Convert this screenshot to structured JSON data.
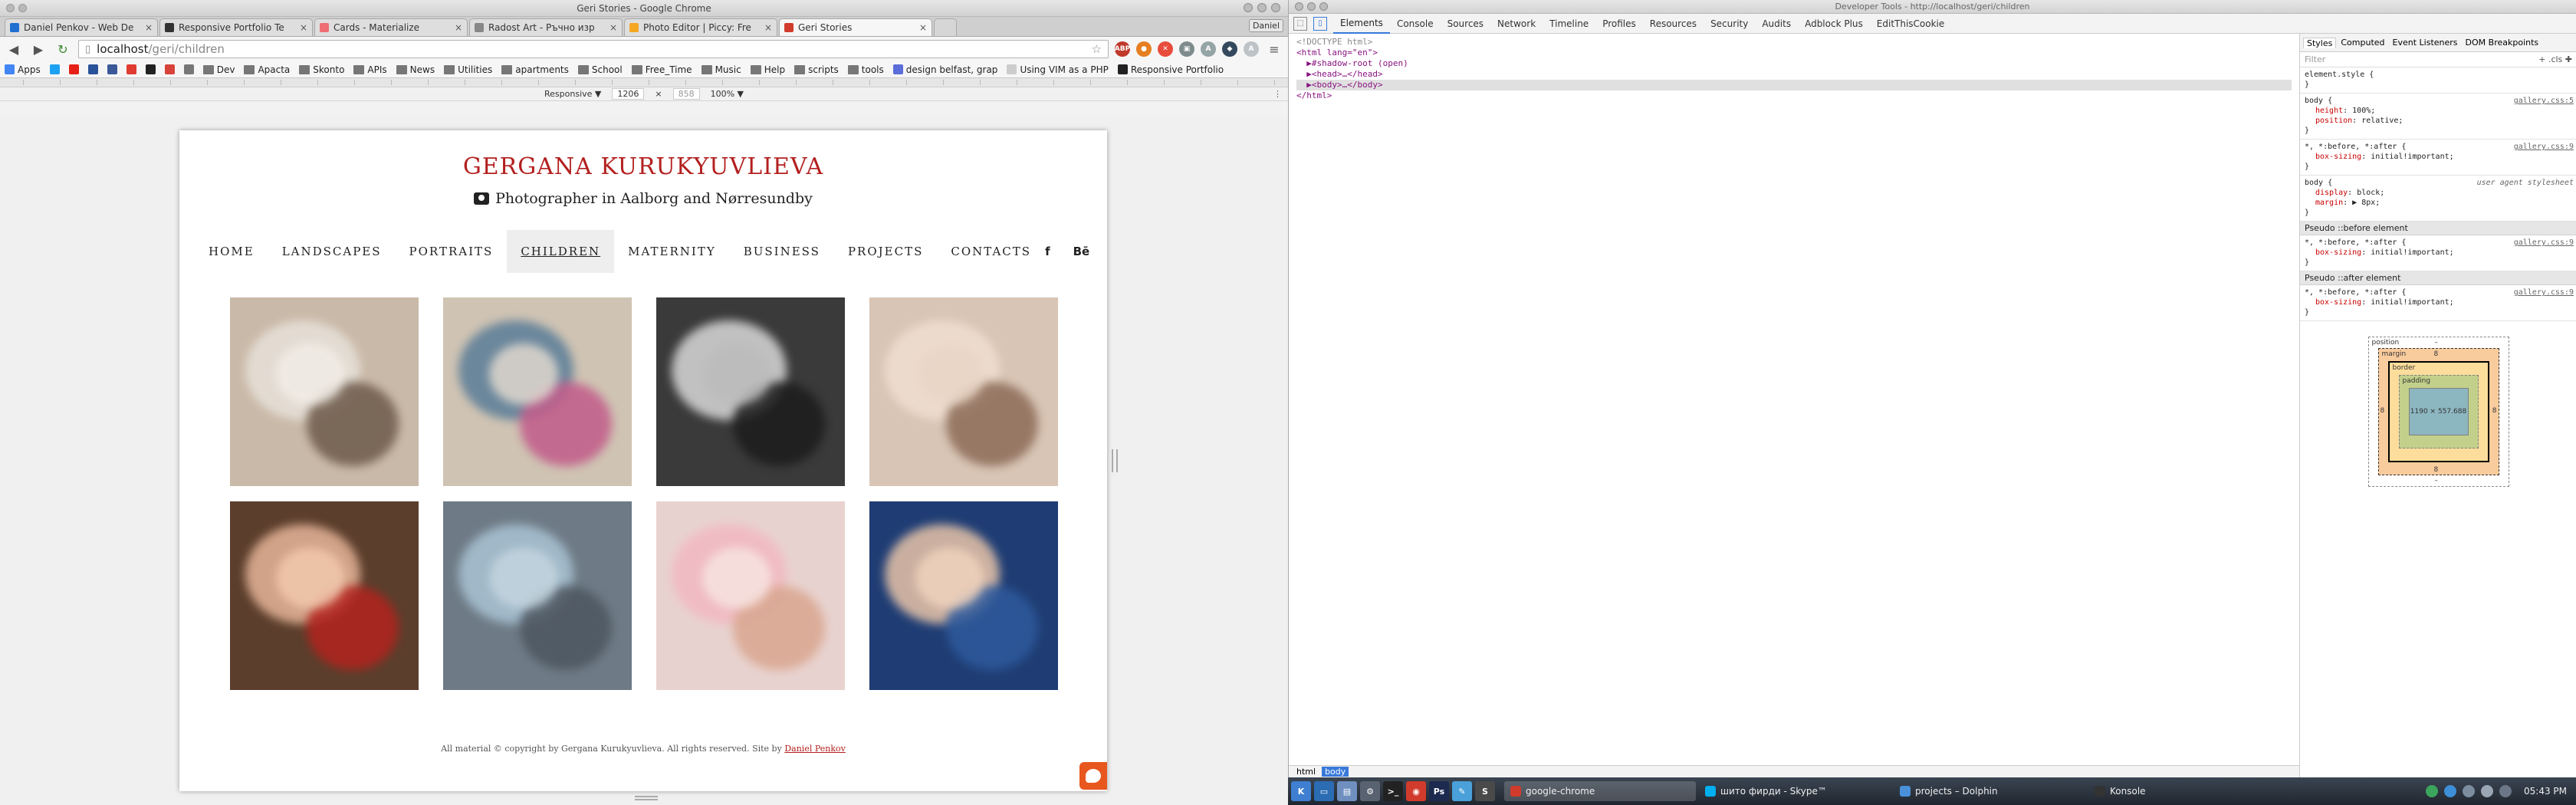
{
  "chrome": {
    "window_title": "Geri Stories - Google Chrome",
    "tabs": [
      {
        "label": "Daniel Penkov - Web De",
        "icon_color": "#1f6fd1",
        "active": false
      },
      {
        "label": "Responsive Portfolio Te",
        "icon_color": "#333333",
        "active": false
      },
      {
        "label": "Cards - Materialize",
        "icon_color": "#ee6e73",
        "active": false
      },
      {
        "label": "Radost Art - Ръчно изр",
        "icon_color": "#888888",
        "active": false
      },
      {
        "label": "Photo Editor | Piccy: Fre",
        "icon_color": "#f5a623",
        "active": false
      },
      {
        "label": "Geri Stories",
        "icon_color": "#d13b2c",
        "active": true
      }
    ],
    "user_label": "Daniel",
    "address": {
      "host": "localhost",
      "path": "/geri/children"
    },
    "bookmarks": [
      {
        "label": "Apps",
        "kind": "site",
        "color": "#4285f4"
      },
      {
        "label": "",
        "kind": "site",
        "color": "#1da1f2"
      },
      {
        "label": "",
        "kind": "site",
        "color": "#e62117"
      },
      {
        "label": "",
        "kind": "site",
        "color": "#2a5298"
      },
      {
        "label": "",
        "kind": "site",
        "color": "#3b5998"
      },
      {
        "label": "",
        "kind": "site",
        "color": "#e03c31"
      },
      {
        "label": "",
        "kind": "site",
        "color": "#222222"
      },
      {
        "label": "",
        "kind": "site",
        "color": "#d7433a"
      },
      {
        "label": "",
        "kind": "site",
        "color": "#777777"
      },
      {
        "label": "Dev",
        "kind": "folder"
      },
      {
        "label": "Apacta",
        "kind": "folder"
      },
      {
        "label": "Skonto",
        "kind": "folder"
      },
      {
        "label": "APIs",
        "kind": "folder"
      },
      {
        "label": "News",
        "kind": "folder"
      },
      {
        "label": "Utilities",
        "kind": "folder"
      },
      {
        "label": "apartments",
        "kind": "folder"
      },
      {
        "label": "School",
        "kind": "folder"
      },
      {
        "label": "Free_Time",
        "kind": "folder"
      },
      {
        "label": "Music",
        "kind": "folder"
      },
      {
        "label": "Help",
        "kind": "folder"
      },
      {
        "label": "scripts",
        "kind": "folder"
      },
      {
        "label": "tools",
        "kind": "folder"
      },
      {
        "label": "design belfast, grap",
        "kind": "site",
        "color": "#5b6dd8"
      },
      {
        "label": "Using VIM as a PHP",
        "kind": "site",
        "color": "#cccccc"
      },
      {
        "label": "Responsive Portfolio",
        "kind": "site",
        "color": "#222222"
      }
    ],
    "device_bar": {
      "mode": "Responsive ▼",
      "width": "1206",
      "height": "858",
      "zoom": "100% ▼"
    }
  },
  "site": {
    "title": "GERGANA KURUKYUVLIEVA",
    "subtitle": "Photographer in Aalborg and Nørresundby",
    "nav": [
      {
        "label": "HOME",
        "active": false
      },
      {
        "label": "LANDSCAPES",
        "active": false
      },
      {
        "label": "PORTRAITS",
        "active": false
      },
      {
        "label": "CHILDREN",
        "active": true
      },
      {
        "label": "MATERNITY",
        "active": false
      },
      {
        "label": "BUSINESS",
        "active": false
      },
      {
        "label": "PROJECTS",
        "active": false
      },
      {
        "label": "CONTACTS",
        "active": false
      }
    ],
    "social": [
      {
        "name": "facebook-icon",
        "glyph": "f"
      },
      {
        "name": "behance-icon",
        "glyph": "Bē"
      },
      {
        "name": "instagram-icon",
        "glyph": "◙"
      }
    ],
    "photos": [
      {
        "name": "photo-baby-on-fur-rug",
        "bg": "#c9b9a8",
        "blobs": [
          "#e8e2da",
          "#6d5a4b",
          "#f1ede6"
        ]
      },
      {
        "name": "photo-two-kids-lying",
        "bg": "#cfc3b3",
        "blobs": [
          "#5a7d98",
          "#c25b8a",
          "#e0d8ce"
        ]
      },
      {
        "name": "photo-sisters-bw",
        "bg": "#3a3a3a",
        "blobs": [
          "#d9d9d9",
          "#1c1c1c",
          "#bcbcbc"
        ]
      },
      {
        "name": "photo-baby-closeup",
        "bg": "#d9c5b5",
        "blobs": [
          "#f0dfd1",
          "#8b6b57",
          "#ead6c7"
        ]
      },
      {
        "name": "photo-baby-red-outfit",
        "bg": "#5b3e2c",
        "blobs": [
          "#e6b599",
          "#b2231e",
          "#f2c9ae"
        ]
      },
      {
        "name": "photo-baby-blue-hat",
        "bg": "#6e7b86",
        "blobs": [
          "#a9c3d4",
          "#4d5660",
          "#c4d5df"
        ]
      },
      {
        "name": "photo-baby-pink-headband",
        "bg": "#e8d2cf",
        "blobs": [
          "#f2b8c1",
          "#d9a68f",
          "#f7e4e1"
        ]
      },
      {
        "name": "photo-newborn-sleeping",
        "bg": "#1f3d74",
        "blobs": [
          "#e8c4a8",
          "#2e5a9c",
          "#f0d3bd"
        ]
      }
    ],
    "footer": {
      "text": "All material © copyright by Gergana Kurukyuvlieva. All rights reserved. Site by",
      "link": "Daniel Penkov"
    }
  },
  "devtools": {
    "window_title": "Developer Tools - http://localhost/geri/children",
    "tabs": [
      "Elements",
      "Console",
      "Sources",
      "Network",
      "Timeline",
      "Profiles",
      "Resources",
      "Security",
      "Audits",
      "Adblock Plus",
      "EditThisCookie"
    ],
    "active_tab": "Elements",
    "dom_lines": [
      {
        "text": "<!DOCTYPE html>",
        "kind": "comment",
        "sel": false
      },
      {
        "text": "<html lang=\"en\">",
        "kind": "tag",
        "sel": false
      },
      {
        "text": "  ▶#shadow-root (open)",
        "kind": "tag",
        "sel": false
      },
      {
        "text": "  ▶<head>…</head>",
        "kind": "tag",
        "sel": false
      },
      {
        "text": "  ▶<body>…</body>",
        "kind": "tag",
        "sel": true
      },
      {
        "text": "</html>",
        "kind": "tag",
        "sel": false
      }
    ],
    "breadcrumbs": [
      {
        "label": "html",
        "sel": false
      },
      {
        "label": "body",
        "sel": true
      }
    ],
    "styles_tabs": [
      "Styles",
      "Computed",
      "Event Listeners",
      "DOM Breakpoints"
    ],
    "filter_placeholder": "Filter",
    "filter_tools": "+  .cls  ✚",
    "rules": [
      {
        "selector": "element.style {",
        "source": "",
        "ua": false,
        "props": [],
        "close": "}"
      },
      {
        "selector": "body {",
        "source": "gallery.css:5",
        "ua": false,
        "props": [
          "height: 100%;",
          "position: relative;"
        ],
        "close": "}"
      },
      {
        "selector": "*, *:before, *:after {",
        "source": "gallery.css:9",
        "ua": false,
        "props": [
          "box-sizing: initial!important;"
        ],
        "close": "}"
      },
      {
        "selector": "body {",
        "source": "user agent stylesheet",
        "ua": true,
        "props": [
          "display: block;",
          "margin: ▶ 8px;"
        ],
        "close": "}"
      }
    ],
    "pseudo_sections": [
      {
        "header": "Pseudo ::before element",
        "selector": "*, *:before, *:after {",
        "source": "gallery.css:9",
        "props": [
          "box-sizing: initial!important;"
        ],
        "close": "}"
      },
      {
        "header": "Pseudo ::after element",
        "selector": "*, *:before, *:after {",
        "source": "gallery.css:9",
        "props": [
          "box-sizing: initial!important;"
        ],
        "close": "}"
      }
    ],
    "box_model": {
      "position": "position",
      "margin_label": "margin",
      "margin": "8",
      "border_label": "border",
      "border": "–",
      "padding_label": "padding",
      "padding": "–",
      "content": "1190 × 557.688",
      "dash": "–"
    }
  },
  "taskbar": {
    "tasks": [
      {
        "label": "google-chrome",
        "color": "#d13b2c",
        "active": true
      },
      {
        "label": "шито фирди - Skype™",
        "color": "#00aff0",
        "active": false
      },
      {
        "label": "projects – Dolphin",
        "color": "#4a90d9",
        "active": false
      },
      {
        "label": "Konsole",
        "color": "#333333",
        "active": false
      }
    ],
    "launchers": [
      {
        "name": "kde-menu-icon",
        "color": "#3f7fd1",
        "glyph": "K"
      },
      {
        "name": "desktop-icon",
        "color": "#2b6cb3",
        "glyph": "▭"
      },
      {
        "name": "files-icon",
        "color": "#6f8fbf",
        "glyph": "▤"
      },
      {
        "name": "settings-icon",
        "color": "#596270",
        "glyph": "⚙"
      },
      {
        "name": "terminal-icon",
        "color": "#222222",
        "glyph": ">_"
      },
      {
        "name": "chrome-icon",
        "color": "#d13b2c",
        "glyph": "◉"
      },
      {
        "name": "photoshop-icon",
        "color": "#1c2a50",
        "glyph": "Ps"
      },
      {
        "name": "editor-icon",
        "color": "#4aa0d9",
        "glyph": "✎"
      },
      {
        "name": "sublime-icon",
        "color": "#4a4a4a",
        "glyph": "S"
      }
    ],
    "clock": "05:43 PM"
  }
}
